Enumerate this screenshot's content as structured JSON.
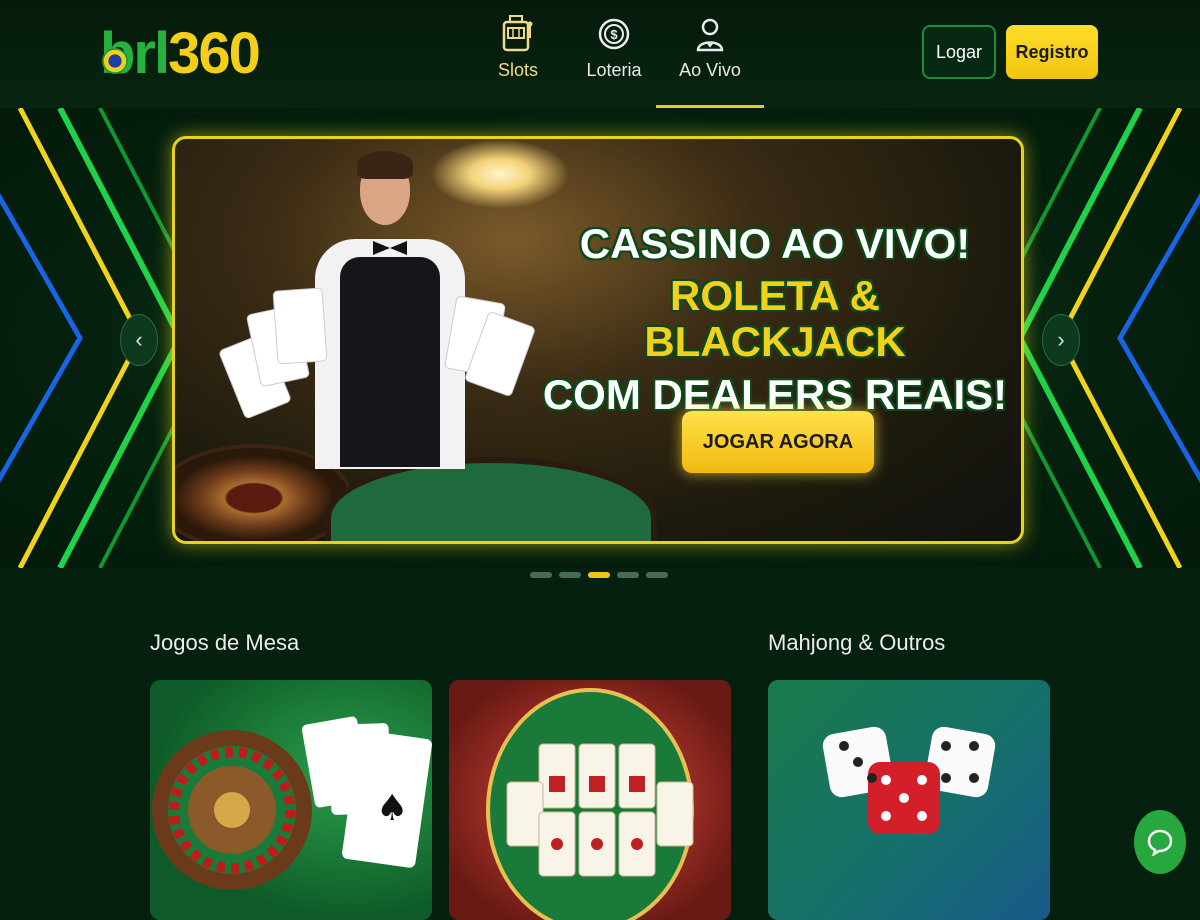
{
  "header": {
    "logo": {
      "part1": "brl",
      "part2": "360"
    },
    "nav": [
      {
        "label": "Slots",
        "icon": "slot-machine-icon"
      },
      {
        "label": "Loteria",
        "icon": "lottery-coin-icon"
      },
      {
        "label": "Ao Vivo",
        "icon": "live-dealer-icon",
        "active": true
      }
    ],
    "login_label": "Logar",
    "register_label": "Registro"
  },
  "hero": {
    "line1": "CASSINO AO VIVO!",
    "line2": "ROLETA & BLACKJACK",
    "line3": "COM DEALERS REAIS!",
    "cta_label": "JOGAR AGORA",
    "slide_count": 5,
    "active_slide": 3
  },
  "sections": [
    {
      "title": "Jogos de Mesa"
    },
    {
      "title": "Mahjong & Outros"
    }
  ],
  "colors": {
    "accent_yellow": "#f4cf1a",
    "brand_green": "#27b23e",
    "background": "#06200f"
  }
}
